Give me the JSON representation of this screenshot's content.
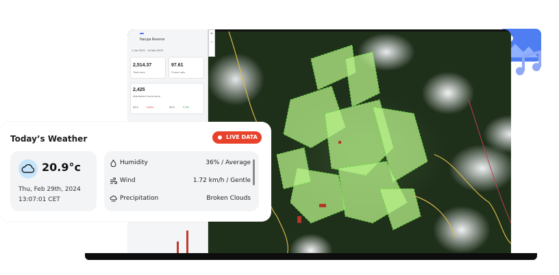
{
  "weather": {
    "title": "Today’s Weather",
    "live_label": "LIVE DATA",
    "temperature": "20.9°c",
    "date": "Thu, Feb 29th, 2024",
    "time": "13:07:01 CET",
    "rows": [
      {
        "label": "Humidity",
        "value": "36% / Average",
        "icon": "droplet-icon"
      },
      {
        "label": "Wind",
        "value": "1.72 km/h / Gentle",
        "icon": "wind-icon"
      },
      {
        "label": "Precipitation",
        "value": "Broken Clouds",
        "icon": "cloud-rain-icon"
      }
    ]
  },
  "dashboard": {
    "badge": "",
    "name": "Narupa Reserve",
    "date_range": "1 Jan 2021 - 16 Mar 2023",
    "metrics": [
      {
        "value": "2,514.37",
        "label": "Total area"
      },
      {
        "value": "97.61",
        "label": "Forest ratio"
      },
      {
        "value": "2,425",
        "label": "Maintained forest area"
      }
    ],
    "small_values": [
      "42.2",
      "1.60%",
      "29.3",
      "3.3%"
    ]
  },
  "colors": {
    "live_badge": "#e8422b",
    "cloud_icon_bg": "#c7e5fa",
    "card_bg": "#f3f4f6",
    "media_icon": "#6a8df3"
  }
}
